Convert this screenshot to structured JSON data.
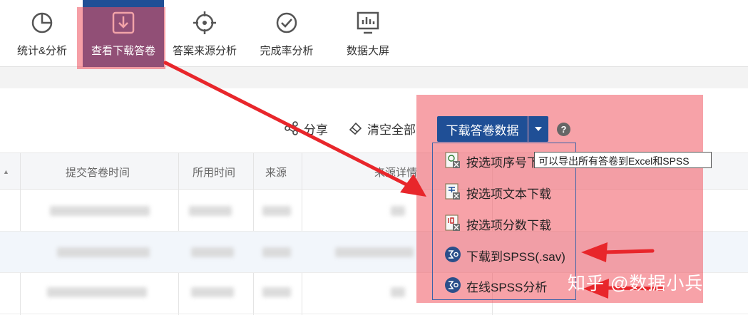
{
  "toolbar": {
    "items": [
      {
        "label": "统计&分析",
        "icon": "pie-chart-icon"
      },
      {
        "label": "查看下载答卷",
        "icon": "download-icon"
      },
      {
        "label": "答案来源分析",
        "icon": "crosshair-icon"
      },
      {
        "label": "完成率分析",
        "icon": "check-circle-icon"
      },
      {
        "label": "数据大屏",
        "icon": "monitor-chart-icon"
      }
    ]
  },
  "actions": {
    "share_label": "分享",
    "clear_label": "清空全部",
    "download_label": "下载答卷数据",
    "help_label": "?"
  },
  "table": {
    "headers": [
      "提交答卷时间",
      "所用时间",
      "来源",
      "来源详情"
    ]
  },
  "dropdown": {
    "items": [
      {
        "label": "按选项序号下载",
        "icon": "excel-number-icon"
      },
      {
        "label": "按选项文本下载",
        "icon": "excel-text-icon"
      },
      {
        "label": "按选项分数下载",
        "icon": "excel-score-icon"
      },
      {
        "label": "下载到SPSS(.sav)",
        "icon": "spss-icon"
      },
      {
        "label": "在线SPSS分析",
        "icon": "spss-icon"
      }
    ],
    "tooltip": "可以导出所有答卷到Excel和SPSS"
  },
  "watermark": "知乎 @数据小兵",
  "colors": {
    "primary": "#1f4f96",
    "annotation": "#e8262b",
    "highlight": "#f0565f"
  }
}
